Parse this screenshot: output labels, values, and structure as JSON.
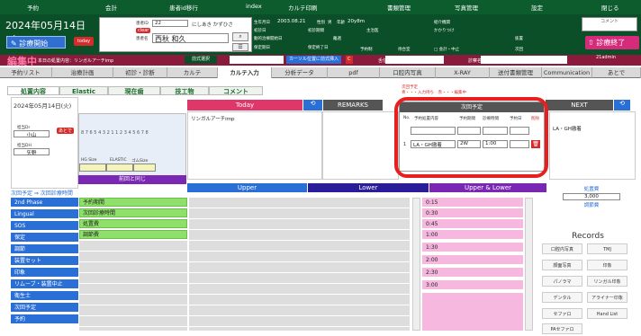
{
  "topmenu": [
    "予約",
    "会計",
    "患者id移行",
    "index",
    "カルテ印刷",
    "書類管理",
    "写真管理",
    "設定",
    "閉じる"
  ],
  "header": {
    "date": "2024年05月14日(火)",
    "shinryo_button": "診療開始",
    "today_button": "today",
    "patient": {
      "id_label": "患者ID",
      "id_value": "22",
      "kana": "にしあき かずひさ",
      "clear": "clear",
      "name_label": "患者名",
      "name_value": "西秋 和久",
      "search_icon": "search-icon",
      "list_icon": "list-icon"
    },
    "info": {
      "birth_label": "生年月日",
      "birth": "2003.08.21",
      "sex_label": "性別",
      "sex": "男",
      "age_label": "年齢",
      "age": "20y8m",
      "clinic_label": "紹介機関",
      "first_label": "初診日",
      "ref_label": "初診期間",
      "hospital_label": "主治医",
      "hospital_value": "かかりつけ",
      "ref2_label": "動的治療開始日",
      "lost": "離週",
      "status": "抜置",
      "retention_label": "保定期日",
      "retention_end": "保定終了日",
      "reserve": "予約制",
      "wait": "待合室",
      "accounting": "会計",
      "accounting_mode": "□ 会計・中止",
      "next": "次回"
    },
    "comment": "コメント",
    "end_button": "診療終了",
    "admin": "21admin"
  },
  "bar2": {
    "title": "編集中",
    "today_appliance": "本日の処置内容：リンガルアーチimp",
    "pre_select": "前式選択",
    "cursor": "カーソル位置に前式挿入",
    "c": "C",
    "tongue": "舌位",
    "mouth": "診察名"
  },
  "tabs": [
    "予約リスト",
    "治療計画",
    "初診・診断",
    "カルテ",
    "カルテ入力",
    "分析データ",
    "pdf",
    "口腔内写真",
    "X-RAY",
    "送付書類管理",
    "Communication",
    "あとで"
  ],
  "subtabs": [
    "処置内容",
    "Elastic",
    "現在歯",
    "技工物",
    "コメント"
  ],
  "left": {
    "date": "2024年05月14日(火)",
    "dr_label": "担当Dr",
    "dr_value": "小山",
    "dh_label": "担当DH",
    "dh_value": "矢野",
    "undo": "あとで"
  },
  "tooth": {
    "upper": "8 7 6 5 4 3 2 1 1 2 3 4 5 6 7 8",
    "hg": "HG Size",
    "elastic": "ELASTIC",
    "gum": "ゴムSize",
    "same": "前回と同じ"
  },
  "next_plan": "次回予定 ⇒ 次回診療時間",
  "left_list": [
    "2nd Phase",
    "Lingual",
    "SOS",
    "保定",
    "調節",
    "装置セット",
    "印象",
    "リムーブ・装置中止",
    "衛生士",
    "次回予定",
    "予約"
  ],
  "green_list": [
    "予約期間",
    "次回診療時間",
    "処置費",
    "調節費"
  ],
  "panel": {
    "today": "Today",
    "remarks": "REMARKS",
    "next": "NEXT",
    "carte_text": "リンガルアーチimp",
    "side_text": "LA・GH撤着",
    "upper": "Upper",
    "lower": "Lower",
    "ul": "Upper & Lower"
  },
  "popup": {
    "hint": "次回予定",
    "hint2": "青・・・入力持ち　赤・・・編集中",
    "header": "次回予定",
    "cols": [
      "No.",
      "予約処置内容",
      "予約期間",
      "診療時間",
      "予約日",
      "削除"
    ],
    "row": {
      "no": "1",
      "content": "LA・GH撤着",
      "period": "2W",
      "time": "1:00"
    }
  },
  "pink_list": [
    "0:15",
    "0:30",
    "0:45",
    "1:00",
    "1:30",
    "2:00",
    "2:30",
    "3:00"
  ],
  "fee": {
    "label": "処置費",
    "value": "3,000",
    "label2": "調節費"
  },
  "records": {
    "title": "Records",
    "items": [
      "口腔内写真",
      "TMJ",
      "顔面写真",
      "印象",
      "パノラマ",
      "リンガル印象",
      "デンタル",
      "アライナー印象",
      "セファロ",
      "Hand List",
      "PAセファロ"
    ]
  },
  "colors": {
    "green": "#0d5c2e",
    "maroon": "#8b1b3d",
    "blue": "#2a6fd6",
    "today": "#e0376a",
    "navy": "#2a1d9a",
    "purple": "#7a28b4",
    "pink": "#f7b8df",
    "red": "#e81f1f"
  }
}
